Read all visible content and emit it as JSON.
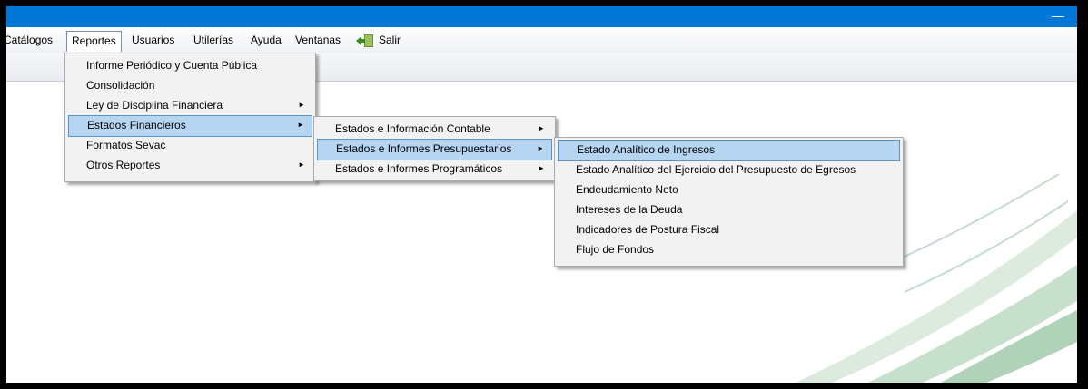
{
  "window": {
    "minimize_glyph": "—"
  },
  "menubar": {
    "items": [
      "Catálogos",
      "Reportes",
      "Usuarios",
      "Utilerías",
      "Ayuda",
      "Ventanas"
    ],
    "salir_label": "Salir"
  },
  "menus": {
    "reportes": [
      "Informe Periódico y Cuenta Pública",
      "Consolidación",
      "Ley de Disciplina Financiera",
      "Estados Financieros",
      "Formatos Sevac",
      "Otros Reportes"
    ],
    "estados_financieros": [
      "Estados e Información Contable",
      "Estados e Informes Presupuestarios",
      "Estados e Informes Programáticos"
    ],
    "informes_presupuestarios": [
      "Estado Analítico de Ingresos",
      "Estado Analítico del Ejercicio del Presupuesto de Egresos",
      "Endeudamiento Neto",
      "Intereses de la Deuda",
      "Indicadores de Postura Fiscal",
      "Flujo de Fondos"
    ]
  },
  "submenu_arrow": "►",
  "colors": {
    "titlebar": "#0078d7",
    "highlight": "#b5d5f1",
    "highlight_border": "#5594cc",
    "menu_bg": "#f2f2f2"
  }
}
